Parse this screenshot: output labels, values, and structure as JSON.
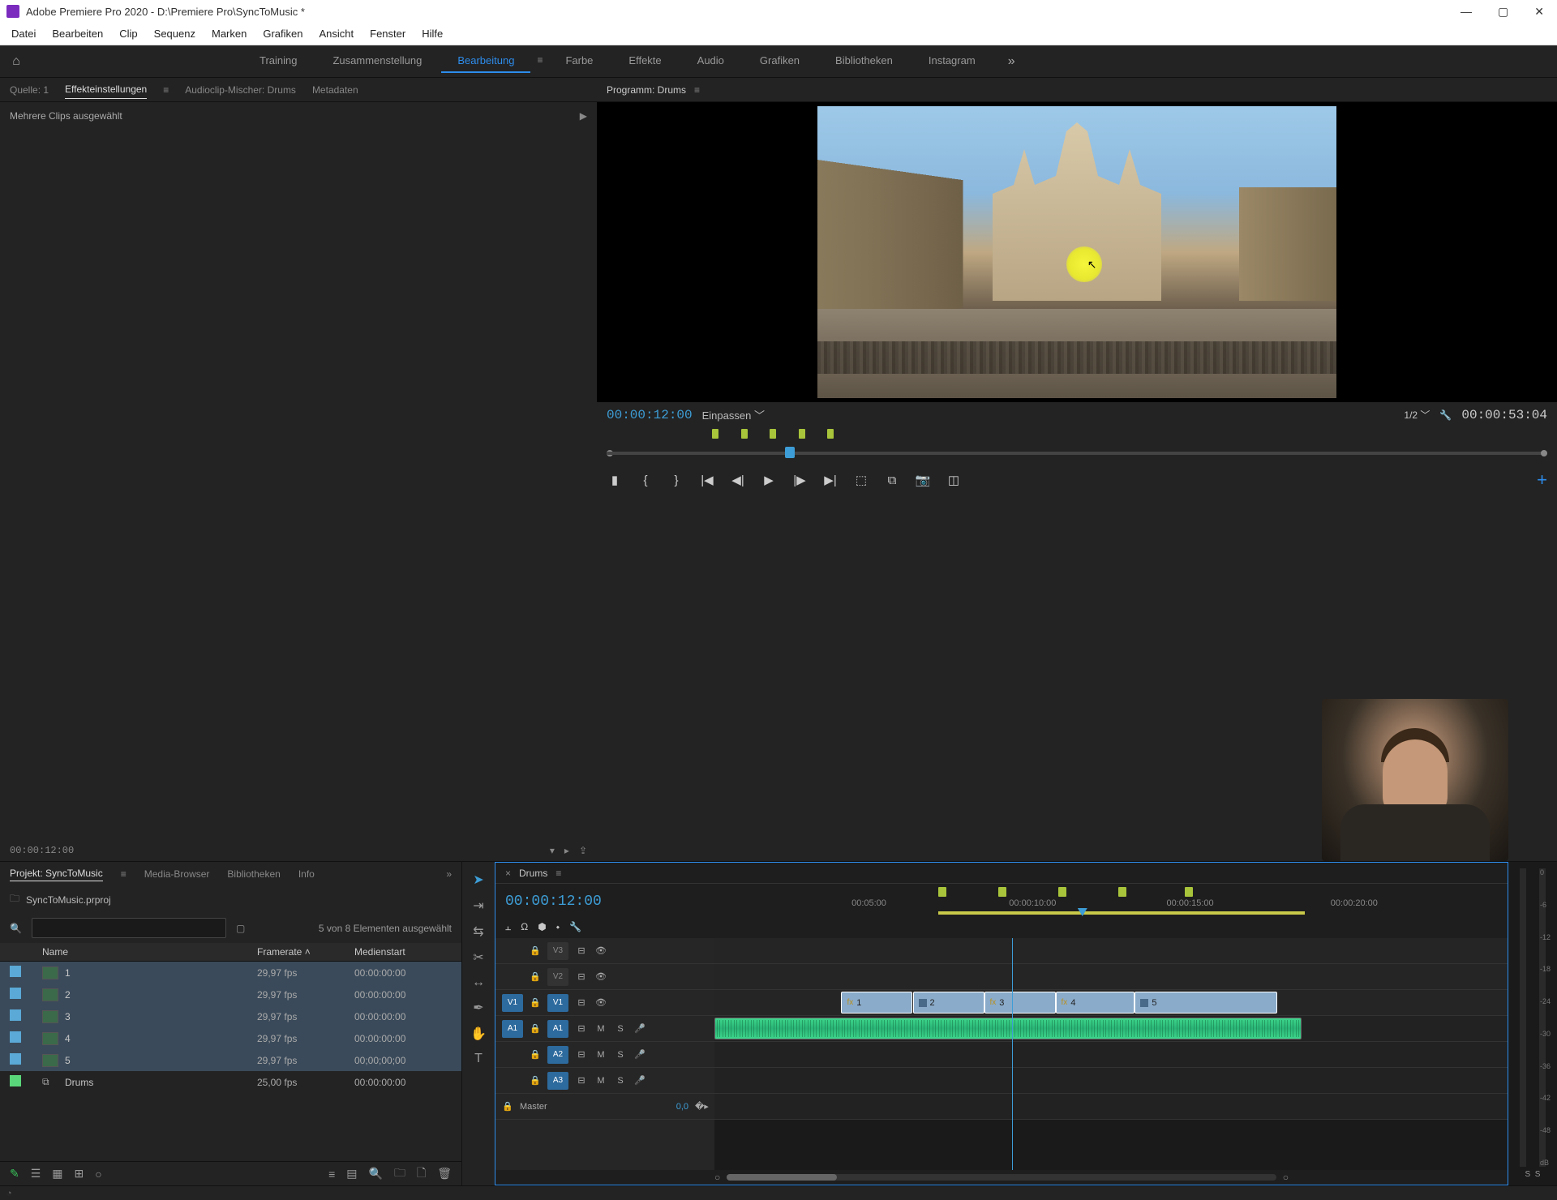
{
  "titlebar": {
    "title": "Adobe Premiere Pro 2020 - D:\\Premiere Pro\\SyncToMusic *"
  },
  "menu": [
    "Datei",
    "Bearbeiten",
    "Clip",
    "Sequenz",
    "Marken",
    "Grafiken",
    "Ansicht",
    "Fenster",
    "Hilfe"
  ],
  "workspaces": {
    "items": [
      "Training",
      "Zusammenstellung",
      "Bearbeitung",
      "Farbe",
      "Effekte",
      "Audio",
      "Grafiken",
      "Bibliotheken",
      "Instagram"
    ],
    "active_index": 2
  },
  "source_tabs": {
    "items": [
      "Quelle: 1",
      "Effekteinstellungen",
      "Audioclip-Mischer: Drums",
      "Metadaten"
    ],
    "active_index": 1,
    "info": "Mehrere Clips ausgewählt",
    "tc": "00:00:12:00"
  },
  "program": {
    "title": "Programm: Drums",
    "tc": "00:00:12:00",
    "fit": "Einpassen",
    "zoom": "1/2",
    "duration": "00:00:53:04",
    "markers_pct": [
      12,
      15,
      18,
      21,
      24
    ],
    "playhead_pct": 19
  },
  "project": {
    "tabs": [
      "Projekt: SyncToMusic",
      "Media-Browser",
      "Bibliotheken",
      "Info"
    ],
    "file": "SyncToMusic.prproj",
    "search_placeholder": "",
    "selection_text": "5 von 8 Elementen ausgewählt",
    "columns": [
      "Name",
      "Framerate",
      "Medienstart"
    ],
    "rows": [
      {
        "label": "blue",
        "name": "1",
        "fps": "29,97 fps",
        "start": "00:00:00:00",
        "sel": true,
        "type": "clip"
      },
      {
        "label": "blue",
        "name": "2",
        "fps": "29,97 fps",
        "start": "00:00:00:00",
        "sel": true,
        "type": "clip"
      },
      {
        "label": "blue",
        "name": "3",
        "fps": "29,97 fps",
        "start": "00:00:00:00",
        "sel": true,
        "type": "clip"
      },
      {
        "label": "blue",
        "name": "4",
        "fps": "29,97 fps",
        "start": "00:00:00:00",
        "sel": true,
        "type": "clip"
      },
      {
        "label": "blue",
        "name": "5",
        "fps": "29,97 fps",
        "start": "00;00;00;00",
        "sel": true,
        "type": "clip"
      },
      {
        "label": "green",
        "name": "Drums",
        "fps": "25,00 fps",
        "start": "00:00:00:00",
        "sel": false,
        "type": "seq"
      }
    ]
  },
  "timeline": {
    "name": "Drums",
    "tc": "00:00:12:00",
    "ruler_ticks": [
      {
        "label": "00:05:00",
        "pct": 3
      },
      {
        "label": "00:00:10:00",
        "pct": 27
      },
      {
        "label": "00:00:15:00",
        "pct": 51
      },
      {
        "label": "00:00:20:00",
        "pct": 76
      }
    ],
    "markers_pct": [
      16,
      25,
      34,
      43,
      53
    ],
    "work_area": {
      "start_pct": 16,
      "end_pct": 71
    },
    "playhead_pct": 37.5,
    "video_tracks": [
      "V3",
      "V2",
      "V1"
    ],
    "audio_tracks": [
      "A1",
      "A2",
      "A3"
    ],
    "master": {
      "label": "Master",
      "value": "0,0"
    },
    "clips": [
      {
        "name": "1",
        "track": "V1",
        "start_pct": 16,
        "width_pct": 9,
        "fx": true
      },
      {
        "name": "2",
        "track": "V1",
        "start_pct": 25,
        "width_pct": 9,
        "fx": false
      },
      {
        "name": "3",
        "track": "V1",
        "start_pct": 34,
        "width_pct": 9,
        "fx": true
      },
      {
        "name": "4",
        "track": "V1",
        "start_pct": 43,
        "width_pct": 10,
        "fx": true
      },
      {
        "name": "5",
        "track": "V1",
        "start_pct": 53,
        "width_pct": 18,
        "fx": false
      }
    ],
    "audio_clip": {
      "track": "A1",
      "start_pct": 0,
      "width_pct": 74
    }
  },
  "meters": {
    "labels": [
      "0",
      "-6",
      "-12",
      "-18",
      "-24",
      "-30",
      "-36",
      "-42",
      "-48",
      "dB"
    ],
    "solo": "S"
  }
}
